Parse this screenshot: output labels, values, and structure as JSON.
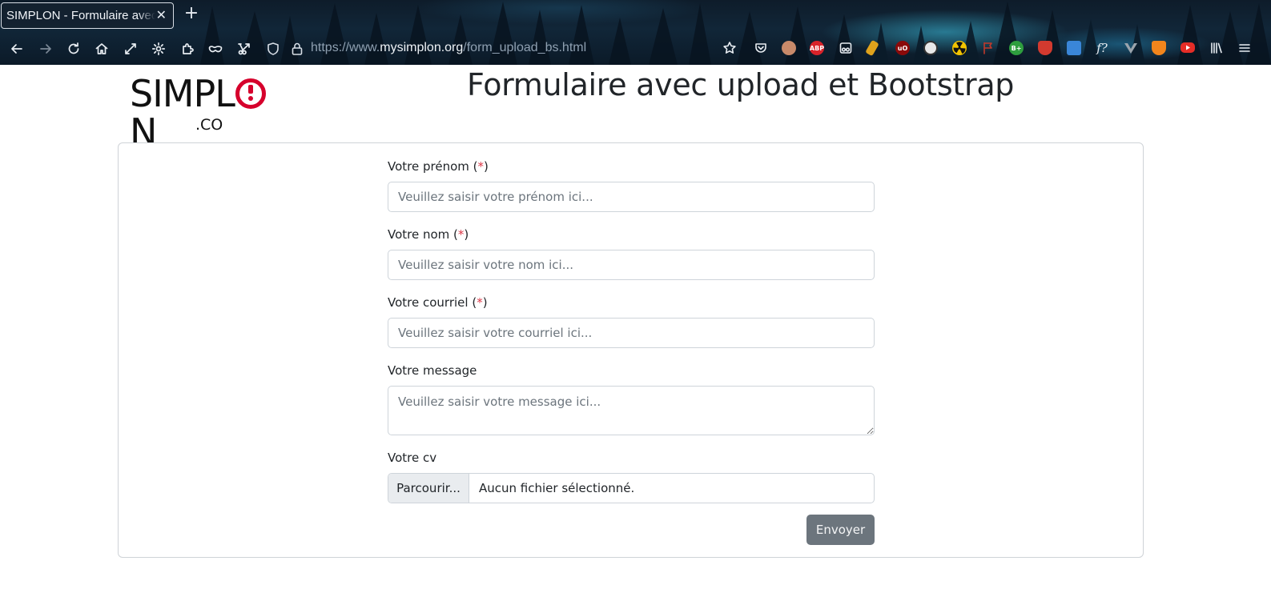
{
  "browser": {
    "tab_title": "SIMPLON - Formulaire avec upload et Bootstrap",
    "tab_close": "✕",
    "new_tab": "+",
    "url_prefix": "https://www.",
    "url_host": "mysimplon.org",
    "url_path": "/form_upload_bs.html",
    "nav_buttons": [
      "back-icon",
      "forward-icon",
      "reload-icon",
      "home-icon",
      "fullscreen-icon",
      "settings-icon",
      "extensions-icon",
      "private-mask-icon",
      "screenshot-icon"
    ],
    "extensions": [
      {
        "name": "bookmark-star-icon"
      },
      {
        "name": "pocket-icon"
      },
      {
        "name": "profile-avatar-icon",
        "color": "#c88a6a"
      },
      {
        "name": "adblock-plus-icon",
        "label": "ABP",
        "color": "#d8232a"
      },
      {
        "name": "reader-glasses-icon"
      },
      {
        "name": "paint-brush-extension-icon",
        "color": "#e0a31c"
      },
      {
        "name": "ublock-origin-icon",
        "label": "uO",
        "color": "#8b0a0a"
      },
      {
        "name": "soccer-ball-extension-icon",
        "color": "#e8e8e8"
      },
      {
        "name": "radioactive-extension-icon",
        "color": "#f3c400"
      },
      {
        "name": "flag-extension-icon",
        "color": "#c0392b"
      },
      {
        "name": "better-plus-icon",
        "label": "B+",
        "color": "#2e9e3e"
      },
      {
        "name": "shield-badge-extension-icon",
        "color": "#d33a2f"
      },
      {
        "name": "file-badge-extension-icon",
        "color": "#3a86d8"
      },
      {
        "name": "font-finder-icon",
        "label": "f?"
      },
      {
        "name": "vue-devtools-icon",
        "color": "#9aa4ad"
      },
      {
        "name": "metamask-fox-icon",
        "color": "#f1851c"
      },
      {
        "name": "youtube-extension-icon",
        "color": "#e52d27"
      },
      {
        "name": "library-icon"
      },
      {
        "name": "menu-hamburger-icon"
      }
    ]
  },
  "logo": {
    "brand_left": "SIMPL",
    "brand_right": "N",
    "suffix": ".CO"
  },
  "page": {
    "title": "Formulaire avec upload et Bootstrap"
  },
  "form": {
    "firstname": {
      "label": "Votre prénom (",
      "required_mark": "*",
      "label_close": ")",
      "placeholder": "Veuillez saisir votre prénom ici...",
      "value": ""
    },
    "lastname": {
      "label": "Votre nom (",
      "required_mark": "*",
      "label_close": ")",
      "placeholder": "Veuillez saisir votre nom ici...",
      "value": ""
    },
    "email": {
      "label": "Votre courriel (",
      "required_mark": "*",
      "label_close": ")",
      "placeholder": "Veuillez saisir votre courriel ici...",
      "value": ""
    },
    "message": {
      "label": "Votre message",
      "placeholder": "Veuillez saisir votre message ici...",
      "value": ""
    },
    "cv": {
      "label": "Votre cv",
      "browse_label": "Parcourir...",
      "file_status": "Aucun fichier sélectionné."
    },
    "submit_label": "Envoyer"
  },
  "colors": {
    "required": "#dc3545",
    "submit_bg": "#6c757d",
    "logo_accent": "#d6002c"
  }
}
